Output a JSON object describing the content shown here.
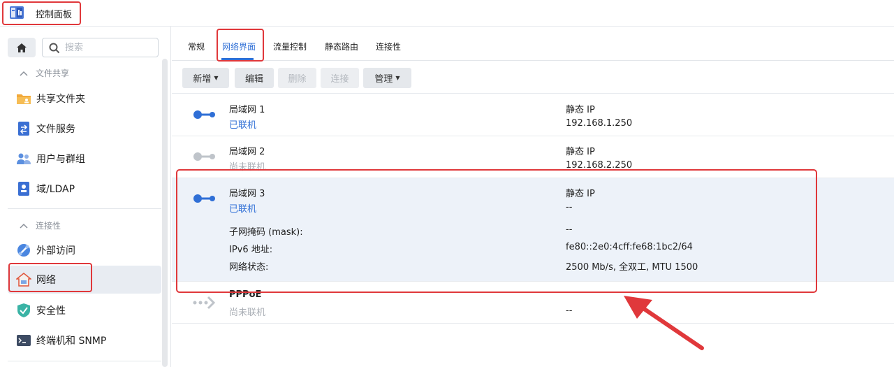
{
  "window": {
    "title": "控制面板",
    "icon": "control-panel-icon"
  },
  "sidebar": {
    "search_placeholder": "搜索",
    "sections": [
      {
        "label": "文件共享",
        "items": [
          {
            "label": "共享文件夹",
            "icon": "shared-folder-icon"
          },
          {
            "label": "文件服务",
            "icon": "file-services-icon"
          },
          {
            "label": "用户与群组",
            "icon": "user-group-icon"
          },
          {
            "label": "域/LDAP",
            "icon": "domain-ldap-icon"
          }
        ]
      },
      {
        "label": "连接性",
        "items": [
          {
            "label": "外部访问",
            "icon": "external-access-icon"
          },
          {
            "label": "网络",
            "icon": "network-icon",
            "active": true
          },
          {
            "label": "安全性",
            "icon": "security-shield-icon"
          },
          {
            "label": "终端机和 SNMP",
            "icon": "terminal-icon"
          }
        ]
      }
    ]
  },
  "tabs": [
    {
      "label": "常规"
    },
    {
      "label": "网络界面",
      "active": true
    },
    {
      "label": "流量控制"
    },
    {
      "label": "静态路由"
    },
    {
      "label": "连接性"
    }
  ],
  "toolbar": {
    "add_label": "新增",
    "edit_label": "编辑",
    "delete_label": "删除",
    "connect_label": "连接",
    "manage_label": "管理"
  },
  "interfaces": [
    {
      "name": "局域网 1",
      "status": "已联机",
      "ip_mode": "静态 IP",
      "ip": "192.168.1.250"
    },
    {
      "name": "局域网 2",
      "status": "尚未联机",
      "ip_mode": "静态 IP",
      "ip": "192.168.2.250"
    },
    {
      "name": "局域网 3",
      "status": "已联机",
      "ip_mode": "静态 IP",
      "ip": "--",
      "details": [
        {
          "label": "子网掩码 (mask):",
          "value": "--"
        },
        {
          "label": "IPv6 地址:",
          "value": "fe80::2e0:4cff:fe68:1bc2/64"
        },
        {
          "label": "网络状态:",
          "value": "2500 Mb/s, 全双工, MTU 1500"
        }
      ]
    },
    {
      "name": "PPPoE",
      "status": "尚未联机",
      "ip": "--"
    }
  ],
  "colors": {
    "accent": "#2f6fd6",
    "highlight_border": "#e0383b",
    "selected_row": "#edf2f9"
  }
}
